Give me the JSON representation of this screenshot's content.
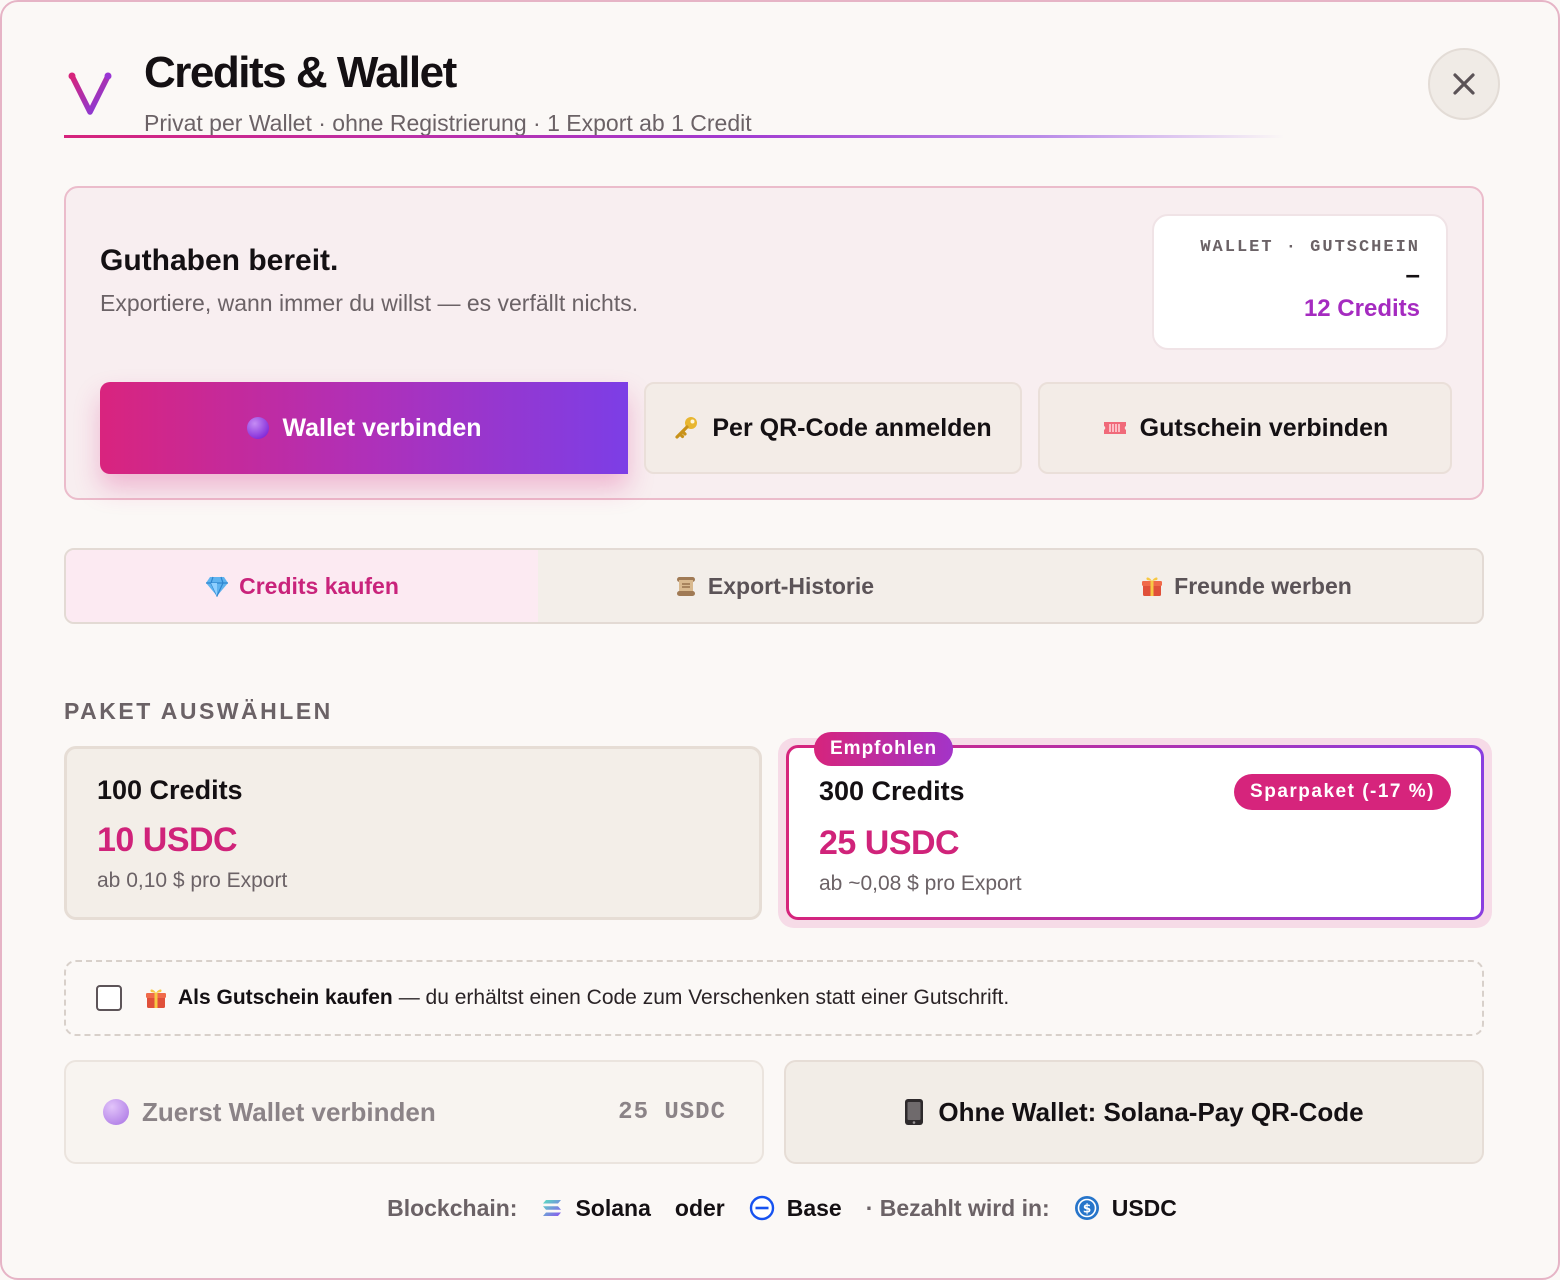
{
  "header": {
    "title": "Credits & Wallet",
    "subtitle": "Privat per Wallet · ohne Registrierung · 1 Export ab 1 Credit",
    "close_label": "✕"
  },
  "status": {
    "heading": "Guthaben bereit.",
    "text": "Exportiere, wann immer du willst — es verfällt nichts.",
    "balance_label": "WALLET · GUTSCHEIN",
    "balance_wallet": "–",
    "balance_credits": "12 Credits",
    "buttons": {
      "wallet": "Wallet verbinden",
      "qr": "Per QR-Code anmelden",
      "voucher": "Gutschein verbinden"
    }
  },
  "tabs": [
    {
      "label": "Credits kaufen",
      "icon": "gem-icon",
      "active": true
    },
    {
      "label": "Export-Historie",
      "icon": "scroll-icon",
      "active": false
    },
    {
      "label": "Freunde werben",
      "icon": "gift-icon",
      "active": false
    }
  ],
  "packages": {
    "section_label": "PAKET AUSWÄHLEN",
    "items": [
      {
        "name": "100 Credits",
        "price": "10 USDC",
        "note": "ab 0,10 $ pro Export",
        "selected": false
      },
      {
        "name": "300 Credits",
        "price": "25 USDC",
        "note": "ab ~0,08 $ pro Export",
        "selected": true,
        "badge": "Empfohlen",
        "tag": "Sparpaket (-17 %)"
      }
    ]
  },
  "gift": {
    "checked": false,
    "strong": "Als Gutschein kaufen",
    "text": "— du erhältst einen Code zum Verschenken statt einer Gutschrift."
  },
  "pay": {
    "disabled_label": "Zuerst Wallet verbinden",
    "disabled_amount": "25 USDC",
    "qr_label": "Ohne Wallet: Solana-Pay QR-Code"
  },
  "footer": {
    "blockchain_label": "Blockchain:",
    "chain_1": "Solana",
    "or": "oder",
    "chain_2": "Base",
    "paid_label": "· Bezahlt wird in:",
    "currency": "USDC"
  },
  "colors": {
    "accent_pink": "#d6247c",
    "accent_purple": "#8a3ee0",
    "credits_purple": "#a52bc0"
  }
}
